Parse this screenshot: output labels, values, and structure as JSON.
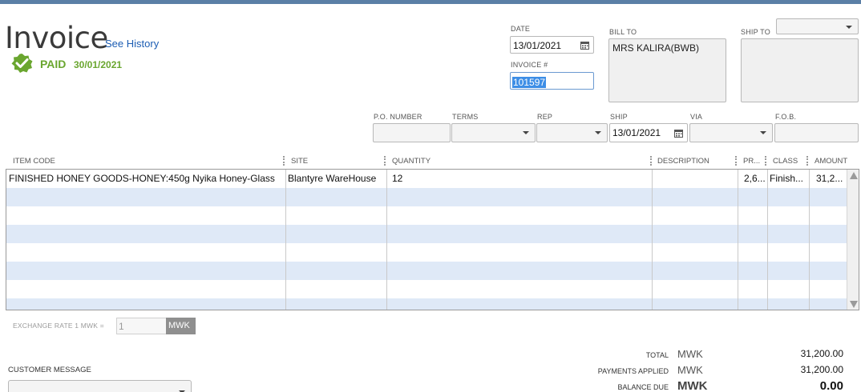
{
  "header": {
    "title": "Invoice",
    "see_history": "See History",
    "status": "PAID",
    "status_date": "30/01/2021",
    "accent_color": "#6aa62f"
  },
  "fields": {
    "date_label": "DATE",
    "date_value": "13/01/2021",
    "invoice_label": "INVOICE #",
    "invoice_value": "101597",
    "bill_to_label": "BILL TO",
    "bill_to_value": "MRS KALIRA(BWB)",
    "ship_to_label": "SHIP TO",
    "ship_to_value": "",
    "po_label": "P.O. NUMBER",
    "po_value": "",
    "terms_label": "TERMS",
    "terms_value": "",
    "rep_label": "REP",
    "rep_value": "",
    "ship_label": "SHIP",
    "ship_value": "13/01/2021",
    "via_label": "VIA",
    "via_value": "",
    "fob_label": "F.O.B.",
    "fob_value": ""
  },
  "grid": {
    "columns": [
      "ITEM CODE",
      "SITE",
      "QUANTITY",
      "DESCRIPTION",
      "PR...",
      "CLASS",
      "AMOUNT"
    ],
    "rows": [
      {
        "item_code": "FINISHED HONEY GOODS-HONEY:450g Nyika Honey-Glass",
        "site": "Blantyre WareHouse",
        "quantity": "12",
        "description": "",
        "price": "2,6...",
        "class": "Finish...",
        "amount": "31,2..."
      }
    ]
  },
  "exchange": {
    "label": "EXCHANGE RATE 1 MWK =",
    "value": "1",
    "currency": "MWK"
  },
  "customer_message": {
    "label": "CUSTOMER MESSAGE"
  },
  "totals": {
    "total_label": "TOTAL",
    "total_currency": "MWK",
    "total_value": "31,200.00",
    "payments_label": "PAYMENTS APPLIED",
    "payments_currency": "MWK",
    "payments_value": "31,200.00",
    "balance_label": "BALANCE DUE",
    "balance_currency": "MWK",
    "balance_value": "0.00"
  },
  "icons": {
    "check": "paid-check-icon",
    "calendar": "calendar-icon",
    "dropdown": "chevron-down-icon"
  }
}
